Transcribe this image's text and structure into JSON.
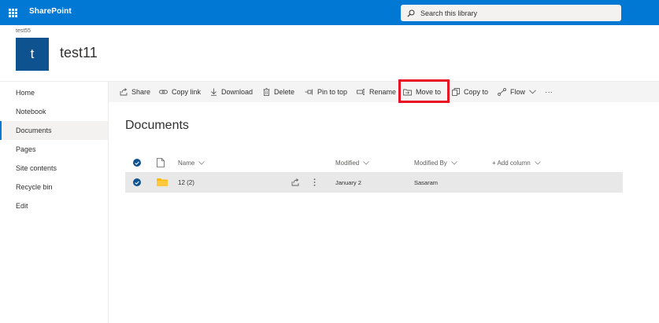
{
  "suite": {
    "brand": "SharePoint",
    "search_placeholder": "Search this library"
  },
  "site": {
    "breadcrumb": "test55",
    "logo_letter": "t",
    "title": "test11"
  },
  "leftnav": {
    "items": [
      {
        "label": "Home",
        "selected": false
      },
      {
        "label": "Notebook",
        "selected": false
      },
      {
        "label": "Documents",
        "selected": true
      },
      {
        "label": "Pages",
        "selected": false
      },
      {
        "label": "Site contents",
        "selected": false
      },
      {
        "label": "Recycle bin",
        "selected": false
      },
      {
        "label": "Edit",
        "selected": false
      }
    ]
  },
  "commandbar": {
    "share": "Share",
    "copy_link": "Copy link",
    "download": "Download",
    "delete": "Delete",
    "pin_to_top": "Pin to top",
    "rename": "Rename",
    "move_to": "Move to",
    "copy_to": "Copy to",
    "flow": "Flow",
    "more": "···"
  },
  "library": {
    "heading": "Documents",
    "columns": {
      "name": "Name",
      "modified": "Modified",
      "modified_by": "Modified By",
      "add_column": "+ Add column"
    },
    "rows": [
      {
        "name": "12 (2)",
        "modified": "January 2",
        "modified_by": "Sasaram",
        "selected": true,
        "type": "folder"
      }
    ]
  },
  "colors": {
    "suitebar": "#0078d4",
    "site_logo": "#0f5290",
    "highlight": "#e81123",
    "folder": "#ffb900"
  },
  "icons": {
    "waffle": "app-launcher-icon",
    "search": "search-icon",
    "share": "share-icon",
    "copy_link": "link-icon",
    "download": "download-icon",
    "delete": "trash-icon",
    "pin": "pin-icon",
    "rename": "rename-icon",
    "move_to": "move-icon",
    "copy_to": "copy-icon",
    "flow": "flow-icon"
  }
}
